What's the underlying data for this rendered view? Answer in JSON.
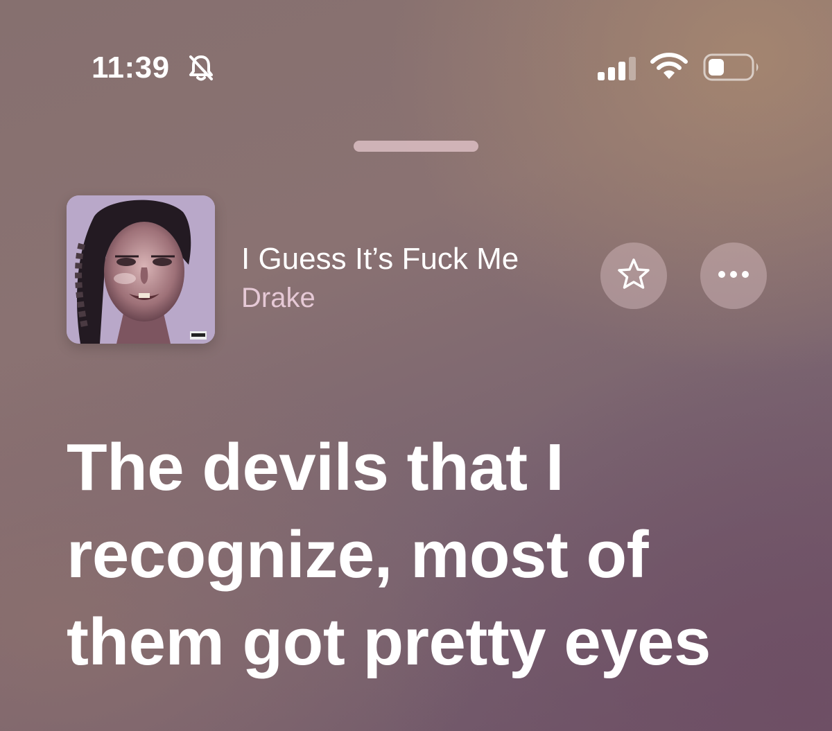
{
  "status_bar": {
    "time": "11:39",
    "icons": [
      "bell-muted-icon",
      "cellular-signal-icon",
      "wifi-icon",
      "battery-icon"
    ]
  },
  "now_playing": {
    "title": "I Guess It’s Fuck Me",
    "artist": "Drake",
    "album_art": "album-art"
  },
  "actions": {
    "favorite_icon": "star-icon",
    "more_icon": "more-icon"
  },
  "lyrics": {
    "current_line": "The devils that I recognize, most of them got pretty eyes"
  },
  "colors": {
    "background_top": "#86706f",
    "background_bottom": "#6e5468",
    "artist_text": "#e6c9d6",
    "button_fill": "#dec4c8"
  }
}
